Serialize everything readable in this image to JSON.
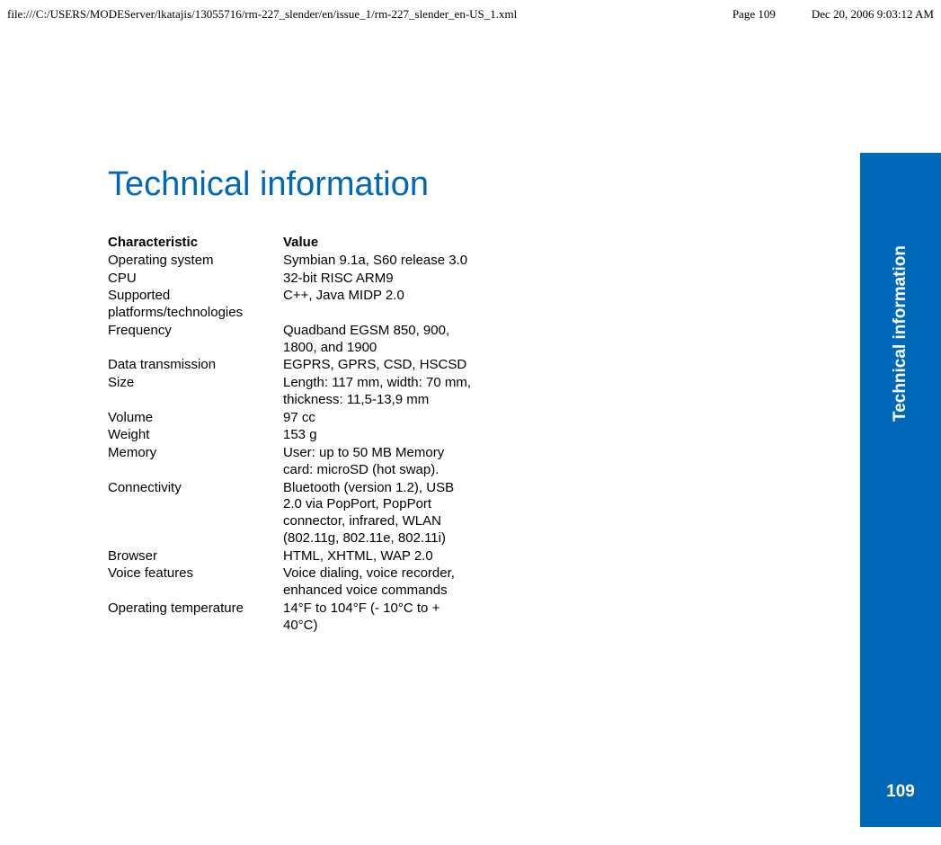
{
  "header": {
    "path": "file:///C:/USERS/MODEServer/lkatajis/13055716/rm-227_slender/en/issue_1/rm-227_slender_en-US_1.xml",
    "page_label": "Page 109",
    "timestamp": "Dec 20, 2006 9:03:12 AM"
  },
  "heading": "Technical information",
  "table": {
    "header_col1": "Characteristic",
    "header_col2": "Value",
    "rows": [
      {
        "label": "Operating system",
        "value": "Symbian 9.1a, S60 release 3.0"
      },
      {
        "label": "CPU",
        "value": "32-bit RISC ARM9"
      },
      {
        "label": "Supported platforms/technologies",
        "value": "C++, Java MIDP 2.0"
      },
      {
        "label": "Frequency",
        "value": "Quadband EGSM 850, 900, 1800, and 1900"
      },
      {
        "label": "Data transmission",
        "value": "EGPRS, GPRS, CSD, HSCSD"
      },
      {
        "label": "Size",
        "value": "Length: 117 mm, width: 70 mm, thickness: 11,5-13,9 mm"
      },
      {
        "label": "Volume",
        "value": "97 cc"
      },
      {
        "label": "Weight",
        "value": "153 g"
      },
      {
        "label": "Memory",
        "value": "User: up to 50 MB Memory card: microSD (hot swap)."
      },
      {
        "label": "Connectivity",
        "value": "Bluetooth (version 1.2), USB 2.0 via PopPort, PopPort connector, infrared, WLAN (802.11g, 802.11e, 802.11i)"
      },
      {
        "label": "Browser",
        "value": "HTML, XHTML, WAP 2.0"
      },
      {
        "label": "Voice features",
        "value": "Voice dialing, voice recorder, enhanced voice commands"
      },
      {
        "label": "Operating temperature",
        "value": "14°F to 104°F (- 10°C to + 40°C)"
      }
    ]
  },
  "side_tab": {
    "label": "Technical information",
    "page_number": "109"
  }
}
